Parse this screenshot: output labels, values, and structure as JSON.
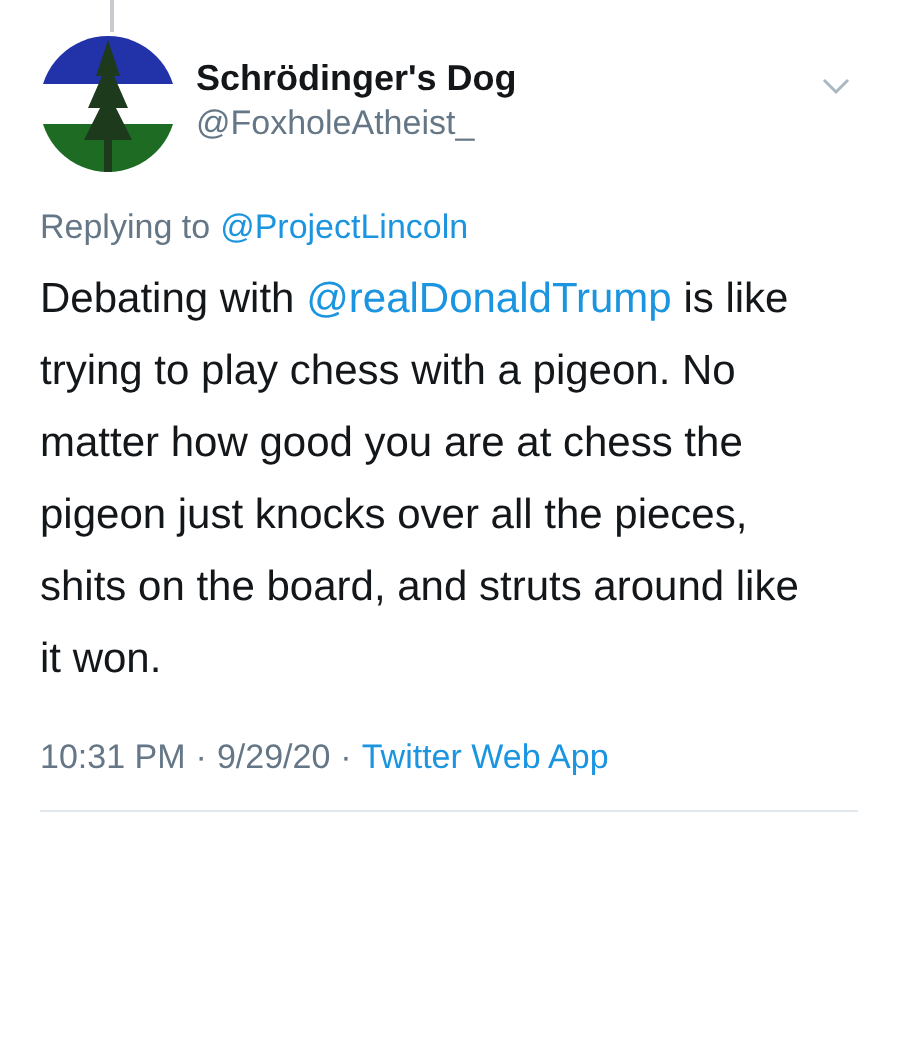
{
  "author": {
    "name": "Schrödinger's Dog",
    "handle": "@FoxholeAtheist_"
  },
  "replying": {
    "label": "Replying to",
    "mention": "@ProjectLincoln"
  },
  "body": [
    {
      "kind": "text",
      "text": "Debating with "
    },
    {
      "kind": "mention",
      "text": "@realDonaldTrump"
    },
    {
      "kind": "text",
      "text": " is like trying to play chess with a pigeon. No matter how good you are at chess the pigeon just knocks over all the pieces, shits on the board, and struts around like it won."
    }
  ],
  "meta": {
    "time": "10:31 PM",
    "separator_1": "·",
    "date": "9/29/20",
    "separator_2": "·",
    "source": "Twitter Web App"
  }
}
